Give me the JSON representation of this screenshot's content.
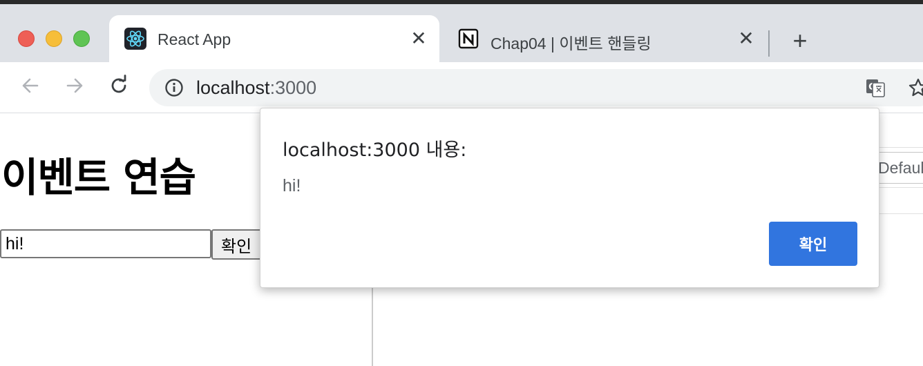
{
  "browser": {
    "tabs": [
      {
        "title": "React App",
        "favicon": "react-logo-icon",
        "active": true
      },
      {
        "title": "Chap04 | 이벤트 핸들링",
        "favicon": "notion-logo-icon",
        "active": false
      }
    ],
    "tab_close_glyph": "✕",
    "new_tab_glyph": "+",
    "address": {
      "host": "localhost",
      "port": ":3000"
    },
    "icons": {
      "back": "arrow-left-icon",
      "forward": "arrow-right-icon",
      "reload": "reload-icon",
      "site_info": "info-icon",
      "translate": "translate-icon",
      "bookmark": "star-icon"
    }
  },
  "page": {
    "title": "이벤트 연습",
    "input_value": "hi!",
    "confirm_label": "확인"
  },
  "devtools": {
    "default_label": "Defaul"
  },
  "alert": {
    "title": "localhost:3000 내용:",
    "message": "hi!",
    "ok_label": "확인",
    "accent_color": "#3175df"
  }
}
